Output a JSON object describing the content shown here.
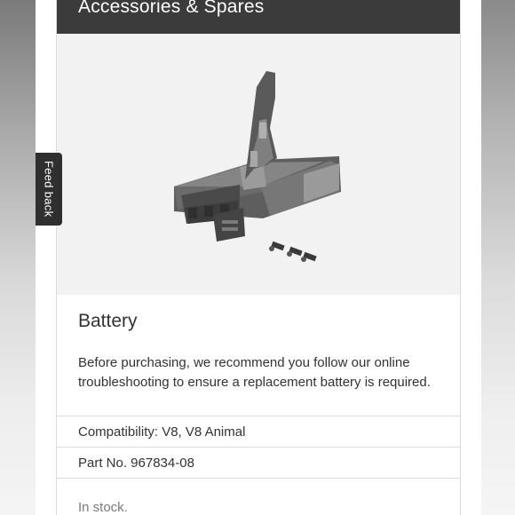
{
  "header": {
    "title": "Accessories & Spares"
  },
  "product": {
    "name": "Battery",
    "description": "Before purchasing, we recommend you follow our online troubleshooting to ensure a replacement battery is required.",
    "compatibility": "Compatibility: V8, V8 Animal",
    "part_number": "Part No. 967834-08",
    "stock": "In stock."
  },
  "feedback": {
    "label": "Feed back"
  },
  "colors": {
    "header_bg": "#3b3b3b",
    "feedback_bg": "#2f2f2f",
    "image_bg": "#f2f2f2"
  }
}
